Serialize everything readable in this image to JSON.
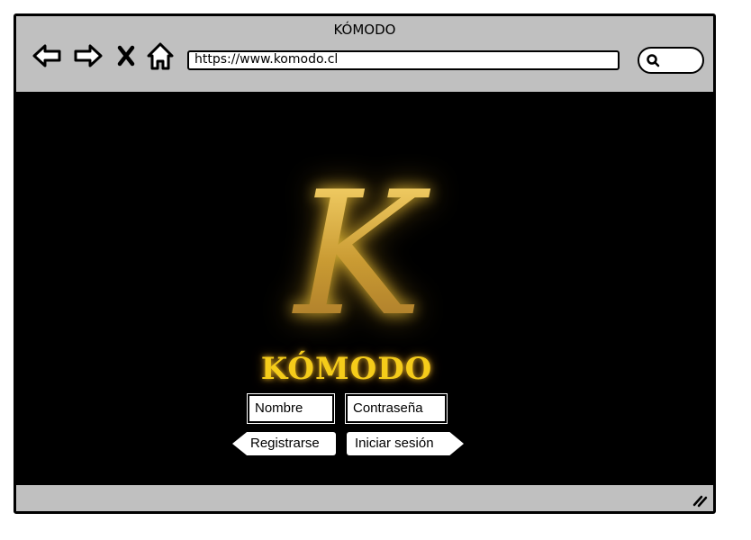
{
  "window": {
    "title": "KÓMODO"
  },
  "toolbar": {
    "back_icon": "back-arrow-icon",
    "forward_icon": "forward-arrow-icon",
    "stop_icon": "close-icon",
    "home_icon": "home-icon",
    "url": "https://www.komodo.cl",
    "search_icon": "search-icon"
  },
  "page": {
    "logo_letter": "K",
    "brand_name": "KÓMODO",
    "username_placeholder": "Nombre",
    "password_placeholder": "Contraseña",
    "register_label": "Registrarse",
    "login_label": "Iniciar sesión"
  },
  "colors": {
    "chrome_gray": "#c0c0c0",
    "page_background": "#000000",
    "logo_gold": "#d8b13c",
    "brand_yellow": "#f5cc1a"
  }
}
